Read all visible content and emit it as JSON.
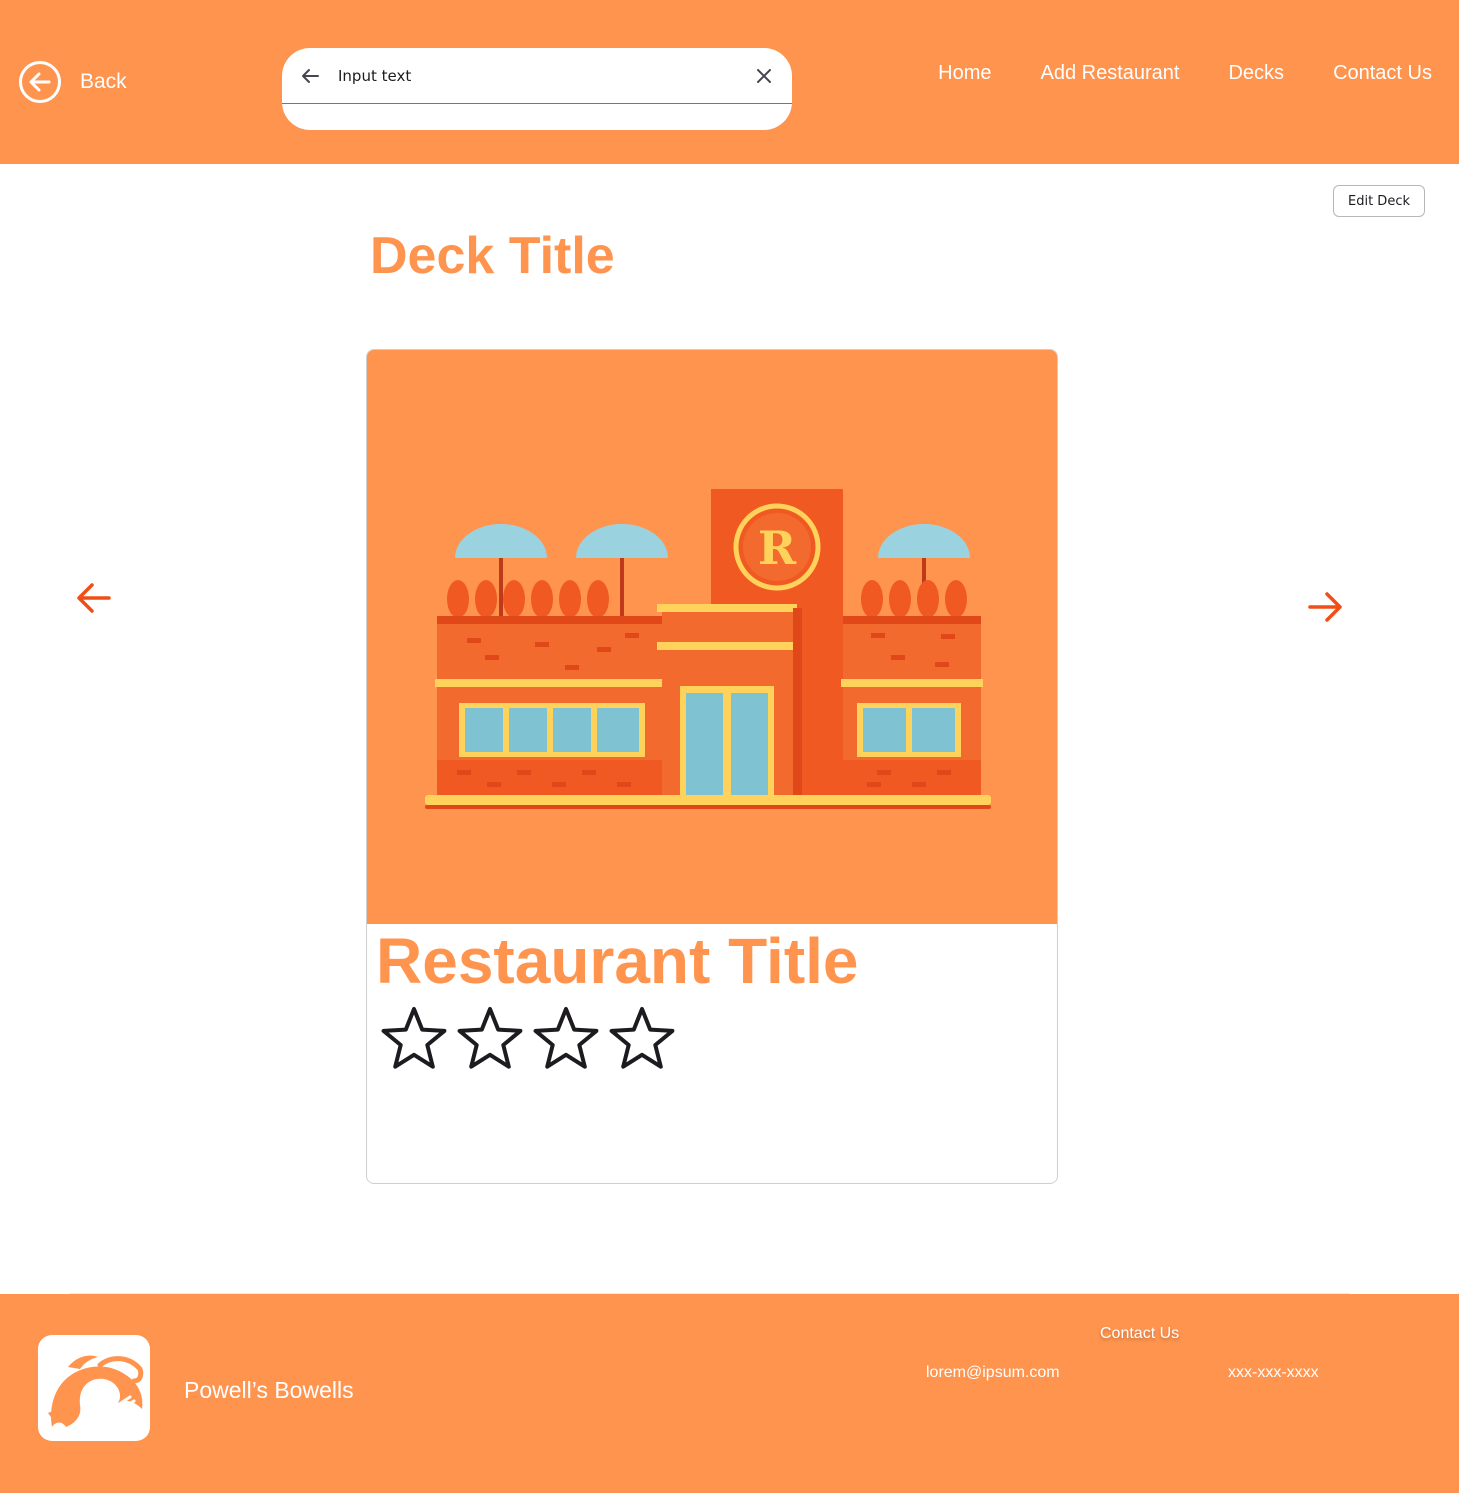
{
  "header": {
    "back_label": "Back",
    "search": {
      "value": "Input text",
      "placeholder": "Input text"
    },
    "nav": [
      "Home",
      "Add Restaurant",
      "Decks",
      "Contact Us"
    ]
  },
  "main": {
    "edit_deck_label": "Edit Deck",
    "deck_title": "Deck Title",
    "card": {
      "restaurant_title": "Restaurant Title",
      "rating": {
        "filled": 0,
        "max": 4
      }
    }
  },
  "footer": {
    "brand": "Powell’s Bowells",
    "contact_heading": "Contact Us",
    "email": "lorem@ipsum.com",
    "phone": "xxx-xxx-xxxx"
  },
  "colors": {
    "brand_orange": "#ff944f",
    "arrow_orange": "#f04e16",
    "building_dark": "#f05a22",
    "building_mid": "#f26a2e",
    "trim_yellow": "#ffd25c",
    "glass_blue": "#7fc3d3",
    "umbrella_blue": "#9bd2e0"
  },
  "icons": [
    "back-circle-icon",
    "arrow-left-icon",
    "close-icon",
    "chevron-left-icon",
    "chevron-right-icon",
    "star-outline-icon",
    "dolphin-fork-logo"
  ]
}
